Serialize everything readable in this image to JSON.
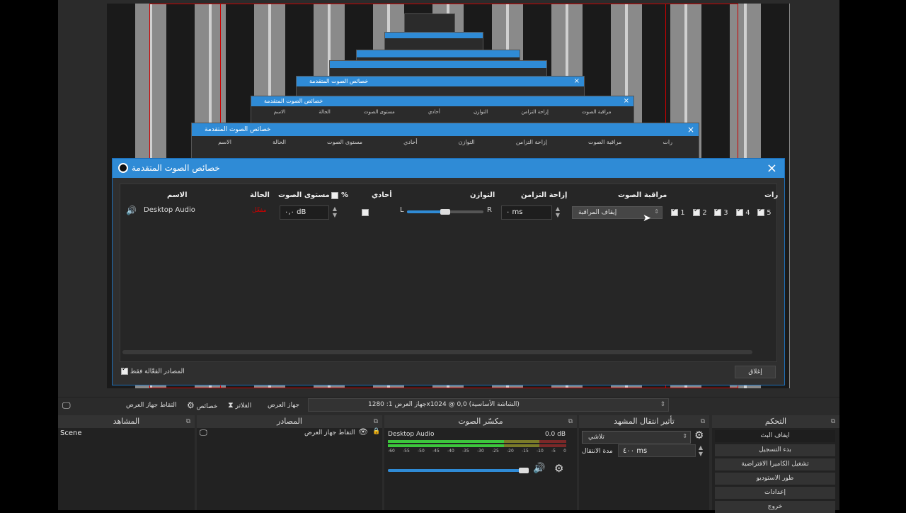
{
  "dialog": {
    "title": "خصائص الصوت المتقدمة",
    "close_label": "إغلاق",
    "active_only_label": "المصادر الفعّالة فقط",
    "columns": {
      "name": "الاسم",
      "status": "الحالة",
      "volume": "مستوى الصوت",
      "percent": "%",
      "mono": "أحادي",
      "balance": "التوازن",
      "sync_offset": "إزاحة التزامن",
      "monitoring": "مراقبة الصوت",
      "tracks": "رات"
    },
    "row": {
      "name": "Desktop Audio",
      "status": "مفعّل",
      "volume_value": "٠,٠ dB",
      "balance_left": "L",
      "balance_right": "R",
      "sync_value": "٠ ms",
      "monitoring_value": "إيقاف المراقبة",
      "tracks": [
        "1",
        "2",
        "3",
        "4",
        "5"
      ]
    }
  },
  "toolbar": {
    "source_name": "التقاط جهاز العرض",
    "properties_label": "خصائص",
    "filters_label": "الفلاتر",
    "display_label": "جهاز العرض",
    "display_value": "جهاز العرض 1: 1280x1024 @ 0,0 (الشاشة الأساسية)"
  },
  "docks": {
    "scenes": {
      "title": "المشاهد",
      "items": [
        "Scene"
      ]
    },
    "sources": {
      "title": "المصادر",
      "items": [
        "التقاط جهاز العرض"
      ]
    },
    "mixer": {
      "title": "مكسّر الصوت",
      "channel_name": "Desktop Audio",
      "channel_db": "0.0 dB",
      "ticks": [
        "-60",
        "-55",
        "-50",
        "-45",
        "-40",
        "-35",
        "-30",
        "-25",
        "-20",
        "-15",
        "-10",
        "-5",
        "0"
      ]
    },
    "transitions": {
      "title": "تأثير انتقال المشهد",
      "type": "تلاشي",
      "duration_label": "مدة الانتقال",
      "duration_value": "٤٠٠ ms"
    },
    "controls": {
      "title": "التحكم",
      "buttons": [
        "ايقاف البث",
        "بدء التسجيل",
        "تشغيل الكاميرا الافتراضية",
        "طور الاستوديو",
        "إعدادات",
        "خروج"
      ]
    }
  },
  "colors": {
    "accent": "#2f8bd6",
    "tunnel_red": "#cc0000",
    "meter_green": "#3cc63c",
    "meter_yellow": "#c8c832",
    "meter_red": "#c83232"
  }
}
